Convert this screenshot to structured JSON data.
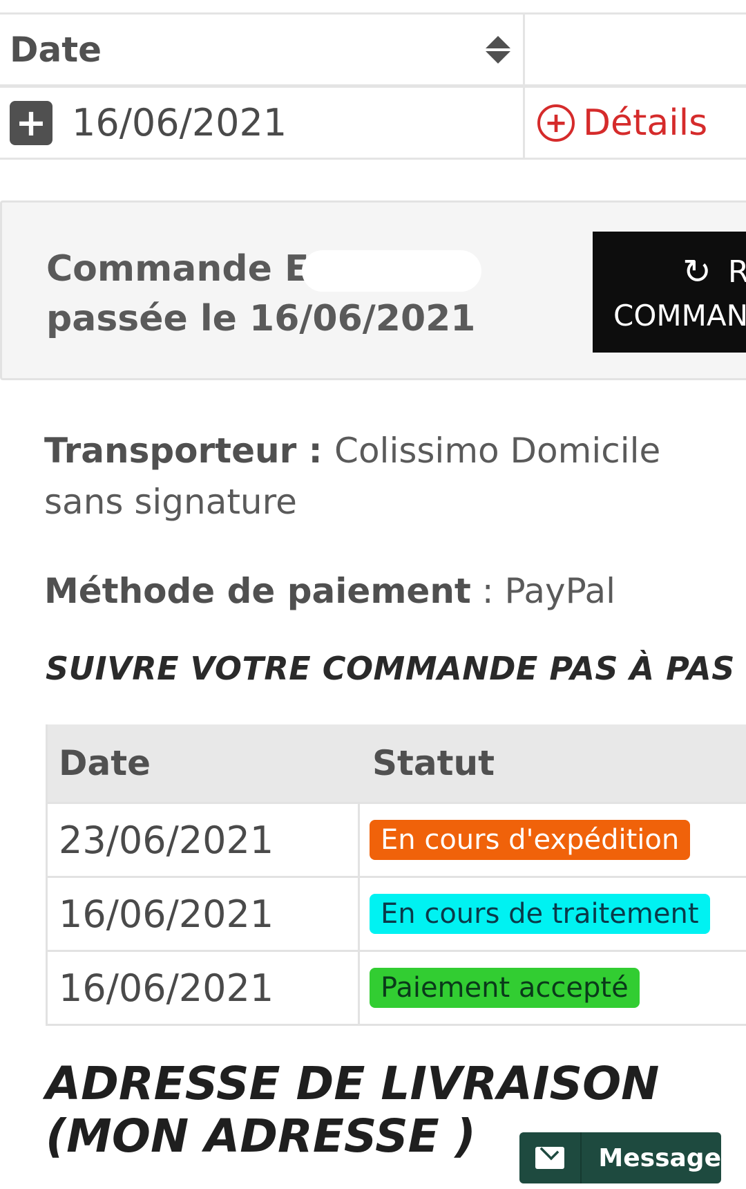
{
  "orders_table": {
    "header": {
      "date_label": "Date",
      "sort_icon": "sort-icon"
    },
    "row": {
      "expand_icon": "+",
      "date": "16/06/2021",
      "details_label": "Détails",
      "details_icon": "plus-circle-icon"
    }
  },
  "order_summary": {
    "title_prefix": "Commande E",
    "title_suffix": "passée le 16/06/2021",
    "reorder_line1": "RE",
    "reorder_line2": "COMMAN",
    "reorder_icon": "refresh-icon"
  },
  "carrier": {
    "label": "Transporteur",
    "value": "Colissimo Domicile sans signature"
  },
  "payment": {
    "label": "Méthode de paiement",
    "value": "PayPal"
  },
  "follow_title": "SUIVRE VOTRE COMMANDE PAS À PAS",
  "status_table": {
    "headers": [
      "Date",
      "Statut"
    ],
    "rows": [
      {
        "date": "23/06/2021",
        "status": "En cours d'expédition",
        "color": "#f0620a",
        "text_color": "#ffffff"
      },
      {
        "date": "16/06/2021",
        "status": "En cours de traitement",
        "color": "#00f2f2",
        "text_color": "#0a3a4a"
      },
      {
        "date": "16/06/2021",
        "status": "Paiement accepté",
        "color": "#32cd32",
        "text_color": "#0a3a1a"
      }
    ]
  },
  "address_title": "ADRESSE DE LIVRAISON (MON ADRESSE )",
  "message_button": {
    "label": "Message",
    "icon": "envelope-icon"
  },
  "colors": {
    "accent_red": "#d52b2b",
    "message_bg": "#1e4a3f",
    "button_black": "#0d0d0d"
  }
}
